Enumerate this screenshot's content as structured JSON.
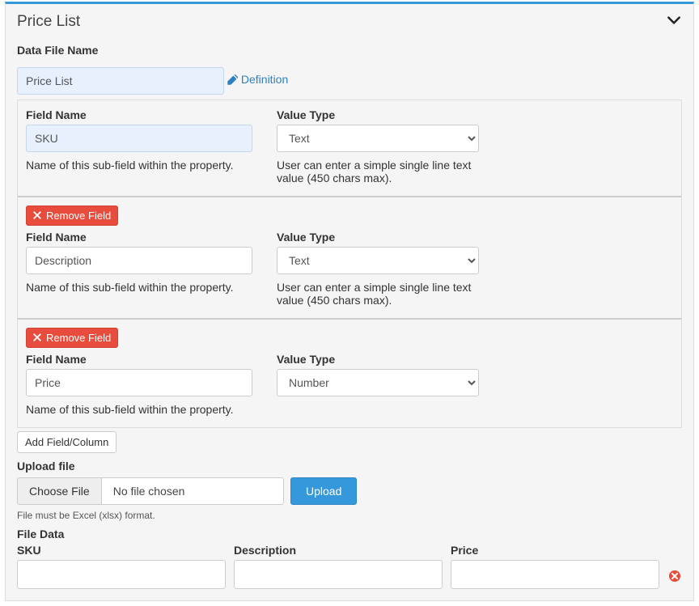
{
  "panel": {
    "title": "Price List"
  },
  "dataFile": {
    "label": "Data File Name",
    "value": "Price List"
  },
  "definitionLink": "Definition",
  "fieldLabels": {
    "fieldName": "Field Name",
    "valueType": "Value Type",
    "fieldHelp": "Name of this sub-field within the property.",
    "textHelp": "User can enter a simple single line text value (450 chars max).",
    "removeField": "Remove Field",
    "addField": "Add Field/Column"
  },
  "valueTypeOptions": [
    "Text",
    "Number"
  ],
  "fields": [
    {
      "name": "SKU",
      "type": "Text",
      "removable": false,
      "highlight": true,
      "help": "text"
    },
    {
      "name": "Description",
      "type": "Text",
      "removable": true,
      "highlight": false,
      "help": "text"
    },
    {
      "name": "Price",
      "type": "Number",
      "removable": true,
      "highlight": false,
      "help": "none"
    }
  ],
  "upload": {
    "label": "Upload file",
    "chooseFile": "Choose File",
    "noFile": "No file chosen",
    "uploadBtn": "Upload",
    "hint": "File must be Excel (xlsx) format."
  },
  "fileData": {
    "label": "File Data",
    "columns": [
      "SKU",
      "Description",
      "Price"
    ],
    "rows": [
      {
        "values": [
          "",
          "",
          ""
        ]
      }
    ]
  }
}
